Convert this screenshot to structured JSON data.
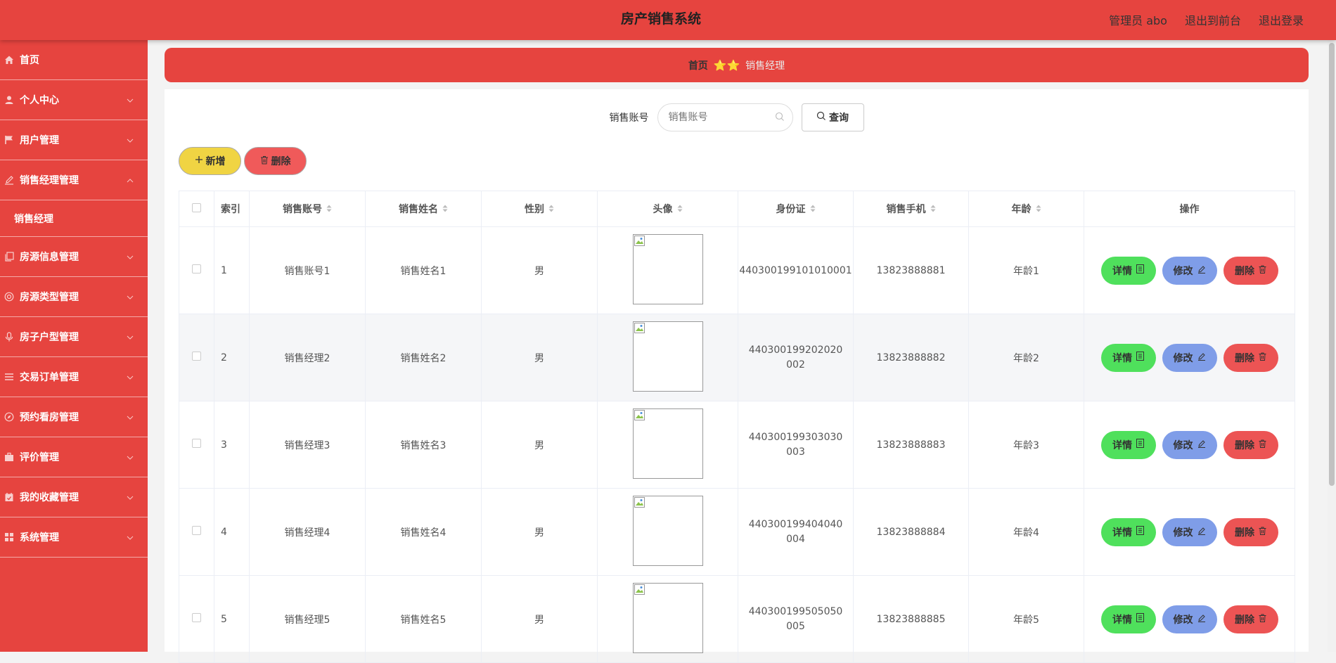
{
  "header": {
    "title": "房产销售系统",
    "admin_label": "管理员 abo",
    "to_front": "退出到前台",
    "logout": "退出登录"
  },
  "sidebar": {
    "items": [
      {
        "label": "首页",
        "icon": "home-icon"
      },
      {
        "label": "个人中心",
        "icon": "user-icon"
      },
      {
        "label": "用户管理",
        "icon": "flag-icon"
      },
      {
        "label": "销售经理管理",
        "icon": "edit-icon"
      },
      {
        "label": "房源信息管理",
        "icon": "copy-icon"
      },
      {
        "label": "房源类型管理",
        "icon": "help-icon"
      },
      {
        "label": "房子户型管理",
        "icon": "mic-icon"
      },
      {
        "label": "交易订单管理",
        "icon": "list-icon"
      },
      {
        "label": "预约看房管理",
        "icon": "compass-icon"
      },
      {
        "label": "评价管理",
        "icon": "briefcase-icon"
      },
      {
        "label": "我的收藏管理",
        "icon": "calendar-icon"
      },
      {
        "label": "系统管理",
        "icon": "grid-icon"
      }
    ],
    "sub_item": "销售经理"
  },
  "breadcrumb": {
    "home": "首页",
    "stars": "⭐⭐",
    "current": "销售经理"
  },
  "search": {
    "label": "销售账号",
    "placeholder": "销售账号",
    "query_button": "查询"
  },
  "actions": {
    "add": "新增",
    "delete": "删除"
  },
  "table": {
    "headers": {
      "index": "索引",
      "account": "销售账号",
      "name": "销售姓名",
      "gender": "性别",
      "avatar": "头像",
      "id_card": "身份证",
      "phone": "销售手机",
      "age": "年龄",
      "ops": "操作"
    },
    "buttons": {
      "detail": "详情",
      "edit": "修改",
      "remove": "删除"
    },
    "rows": [
      {
        "index": "1",
        "account": "销售账号1",
        "name": "销售姓名1",
        "gender": "男",
        "id_card": "440300199101010001",
        "phone": "13823888881",
        "age": "年龄1"
      },
      {
        "index": "2",
        "account": "销售经理2",
        "name": "销售姓名2",
        "gender": "男",
        "id_card": "440300199202020002",
        "phone": "13823888882",
        "age": "年龄2"
      },
      {
        "index": "3",
        "account": "销售经理3",
        "name": "销售姓名3",
        "gender": "男",
        "id_card": "440300199303030003",
        "phone": "13823888883",
        "age": "年龄3"
      },
      {
        "index": "4",
        "account": "销售经理4",
        "name": "销售姓名4",
        "gender": "男",
        "id_card": "440300199404040004",
        "phone": "13823888884",
        "age": "年龄4"
      },
      {
        "index": "5",
        "account": "销售经理5",
        "name": "销售姓名5",
        "gender": "男",
        "id_card": "440300199505050005",
        "phone": "13823888885",
        "age": "年龄5"
      }
    ]
  },
  "colors": {
    "brand": "#e6443f",
    "detail": "#4fe05c",
    "edit": "#7f9de8",
    "remove": "#ec5454",
    "add": "#f0d443"
  }
}
